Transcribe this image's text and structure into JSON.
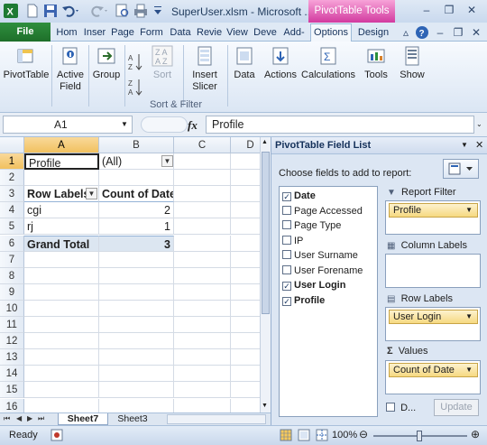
{
  "window": {
    "title": "SuperUser.xlsm - Microsoft ...",
    "context_title": "PivotTable Tools"
  },
  "tabs": [
    "File",
    "Hom",
    "Inser",
    "Page",
    "Form",
    "Data",
    "Revie",
    "View",
    "Deve",
    "Add-",
    "Options",
    "Design"
  ],
  "ribbon": {
    "pivottable": "PivotTable",
    "active_field_1": "Active",
    "active_field_2": "Field",
    "group": "Group",
    "sort": "Sort",
    "insert_1": "Insert",
    "insert_2": "Slicer",
    "data": "Data",
    "actions": "Actions",
    "calculations": "Calculations",
    "tools": "Tools",
    "show": "Show",
    "group_label": "Sort & Filter"
  },
  "formula_bar": {
    "name_box": "A1",
    "fx": "fx",
    "value": "Profile"
  },
  "columns": [
    "A",
    "B",
    "C",
    "D"
  ],
  "rows": [
    "1",
    "2",
    "3",
    "4",
    "5",
    "6",
    "7",
    "8",
    "9",
    "10",
    "11",
    "12",
    "13",
    "14",
    "15",
    "16"
  ],
  "cells": {
    "a1": "Profile",
    "b1": "(All)",
    "a3": "Row Labels",
    "b3": "Count of Date",
    "a4": "cgi",
    "b4": "2",
    "a5": "rj",
    "b5": "1",
    "a6": "Grand Total",
    "b6": "3"
  },
  "sheet_tabs": [
    "Sheet7",
    "Sheet3"
  ],
  "status": {
    "ready": "Ready",
    "zoom": "100%"
  },
  "pivot_pane": {
    "title": "PivotTable Field List",
    "choose_label": "Choose fields to add to report:",
    "fields": [
      {
        "label": "Date",
        "checked": "✓"
      },
      {
        "label": "Page Accessed",
        "checked": ""
      },
      {
        "label": "Page Type",
        "checked": ""
      },
      {
        "label": "IP",
        "checked": ""
      },
      {
        "label": "User Surname",
        "checked": ""
      },
      {
        "label": "User Forename",
        "checked": ""
      },
      {
        "label": "User Login",
        "checked": "✓"
      },
      {
        "label": "Profile",
        "checked": "✓"
      }
    ],
    "report_filter_label": "Report Filter",
    "report_filter_value": "Profile",
    "column_labels_label": "Column Labels",
    "row_labels_label": "Row Labels",
    "row_labels_value": "User Login",
    "values_label": "Values",
    "values_value": "Count of Date",
    "defer_label": "D...",
    "update_label": "Update"
  },
  "colors": {
    "file_tab": "#1e6f2a",
    "context_tab": "#d23a9f",
    "selected_header": "#f1c15f",
    "pill": "#f6d981"
  }
}
